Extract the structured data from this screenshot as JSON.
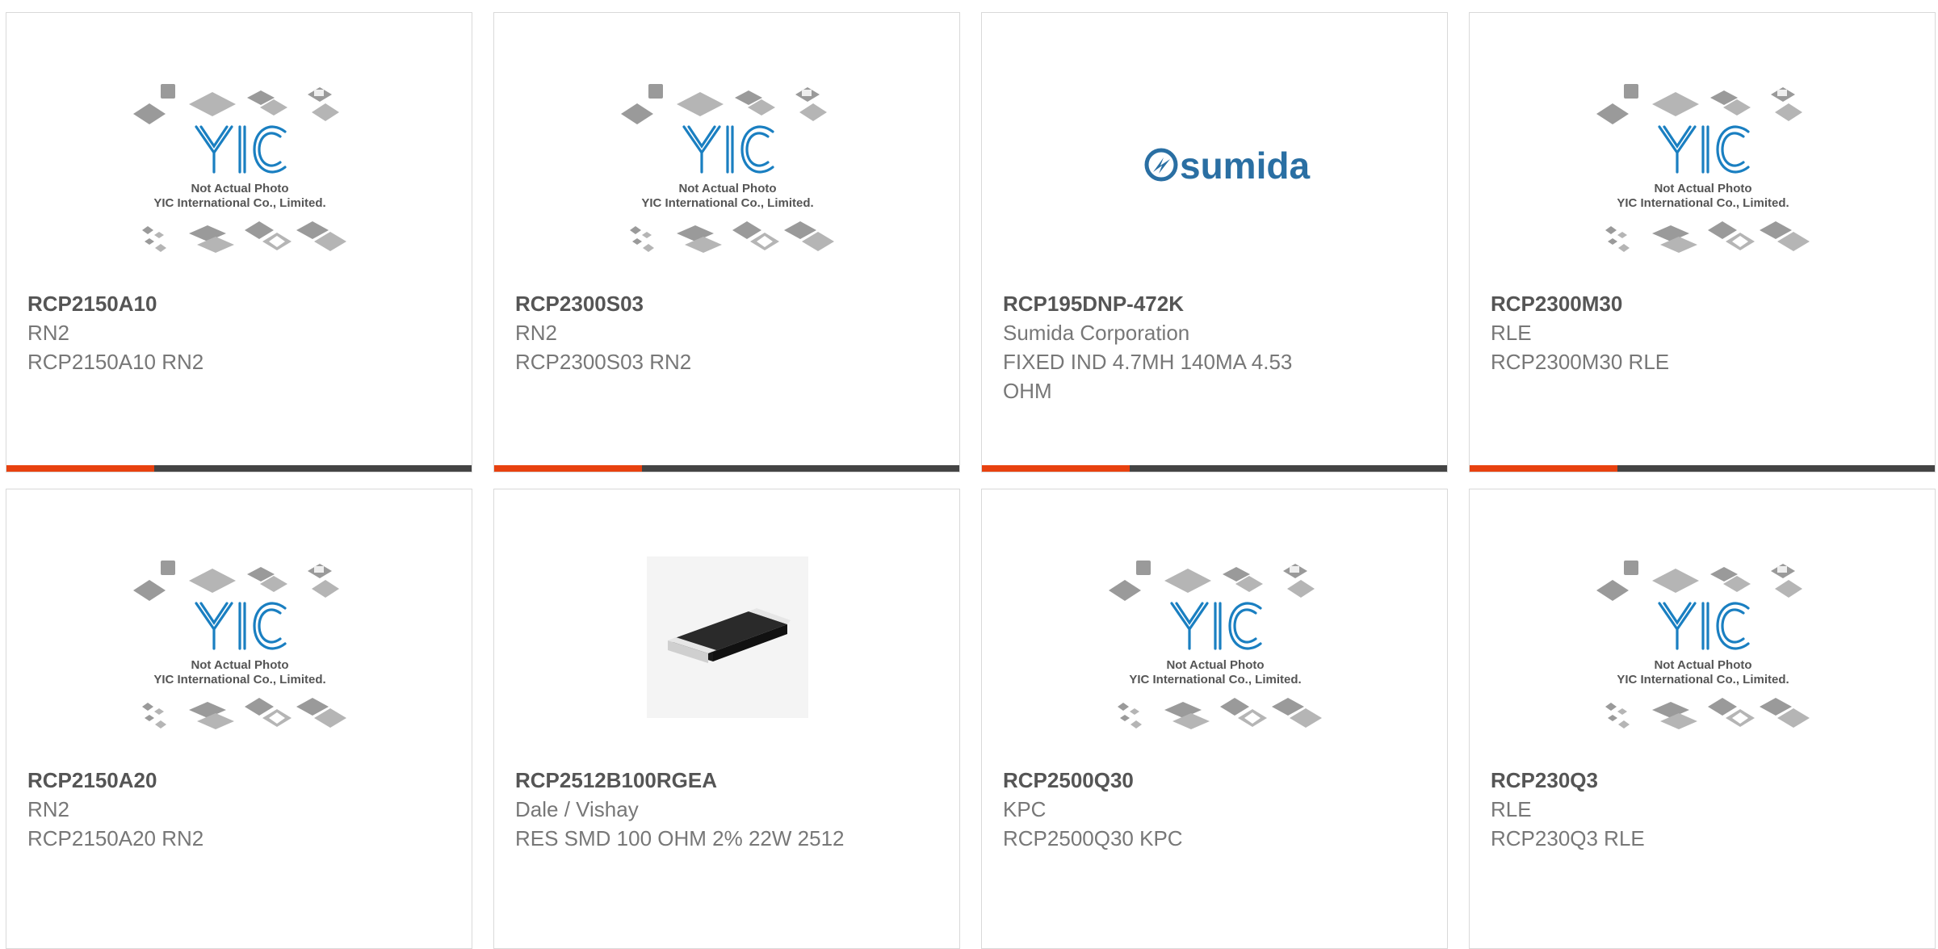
{
  "colors": {
    "accent": "#e8410f",
    "bar": "#444444",
    "yic_blue": "#1a7fc1",
    "sumida_blue": "#2a6fa3"
  },
  "placeholder": {
    "line1": "Not Actual Photo",
    "line2": "YIC International Co., Limited."
  },
  "sumida_logo_text": "sumida",
  "products": [
    {
      "part": "RCP2150A10",
      "manufacturer": "RN2",
      "description": "RCP2150A10 RN2",
      "image": "yic-placeholder"
    },
    {
      "part": "RCP2300S03",
      "manufacturer": "RN2",
      "description": "RCP2300S03 RN2",
      "image": "yic-placeholder"
    },
    {
      "part": "RCP195DNP-472K",
      "manufacturer": "Sumida Corporation",
      "description": "FIXED IND 4.7MH 140MA 4.53 OHM",
      "image": "sumida-logo"
    },
    {
      "part": "RCP2300M30",
      "manufacturer": "RLE",
      "description": "RCP2300M30 RLE",
      "image": "yic-placeholder"
    },
    {
      "part": "RCP2150A20",
      "manufacturer": "RN2",
      "description": "RCP2150A20 RN2",
      "image": "yic-placeholder"
    },
    {
      "part": "RCP2512B100RGEA",
      "manufacturer": "Dale / Vishay",
      "description": "RES SMD 100 OHM 2% 22W 2512",
      "image": "smd-resistor-photo"
    },
    {
      "part": "RCP2500Q30",
      "manufacturer": "KPC",
      "description": "RCP2500Q30 KPC",
      "image": "yic-placeholder"
    },
    {
      "part": "RCP230Q3",
      "manufacturer": "RLE",
      "description": "RCP230Q3 RLE",
      "image": "yic-placeholder"
    }
  ]
}
